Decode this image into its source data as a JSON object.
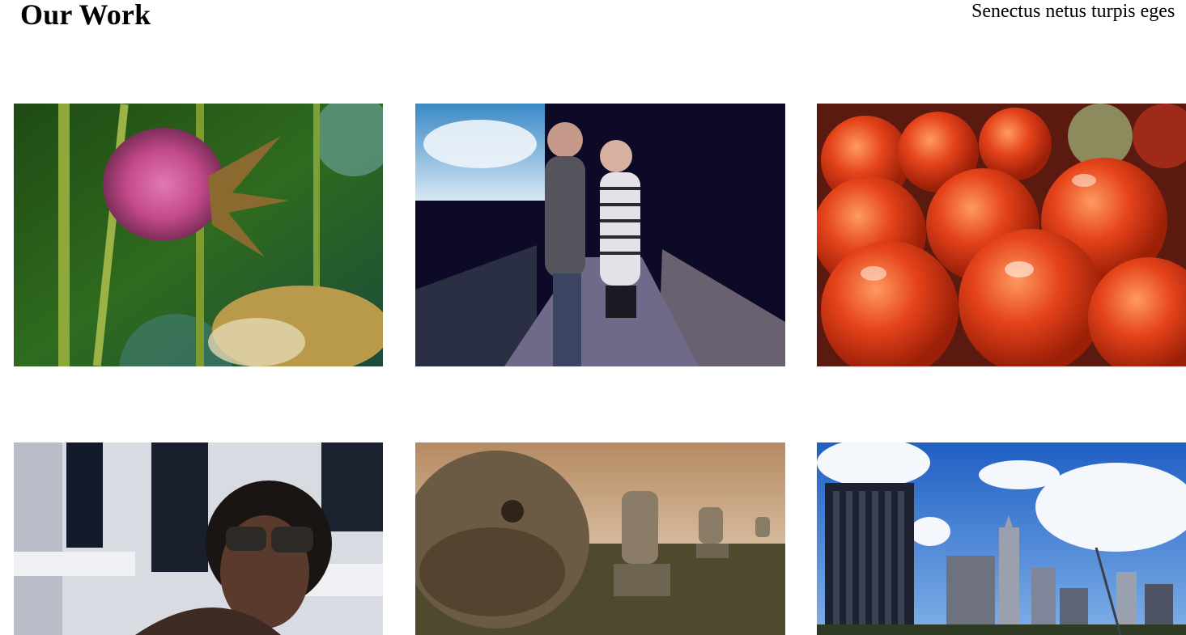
{
  "header": {
    "title": "Our Work",
    "tagline": "Senectus netus turpis eges"
  },
  "gallery": {
    "items": [
      {
        "subject": "pink-thistle-flower-photo"
      },
      {
        "subject": "couple-on-bridge-photo"
      },
      {
        "subject": "red-tomatoes-photo"
      },
      {
        "subject": "woman-with-sunglasses-photo"
      },
      {
        "subject": "stone-lion-statues-photo"
      },
      {
        "subject": "city-skyline-photo"
      }
    ]
  }
}
